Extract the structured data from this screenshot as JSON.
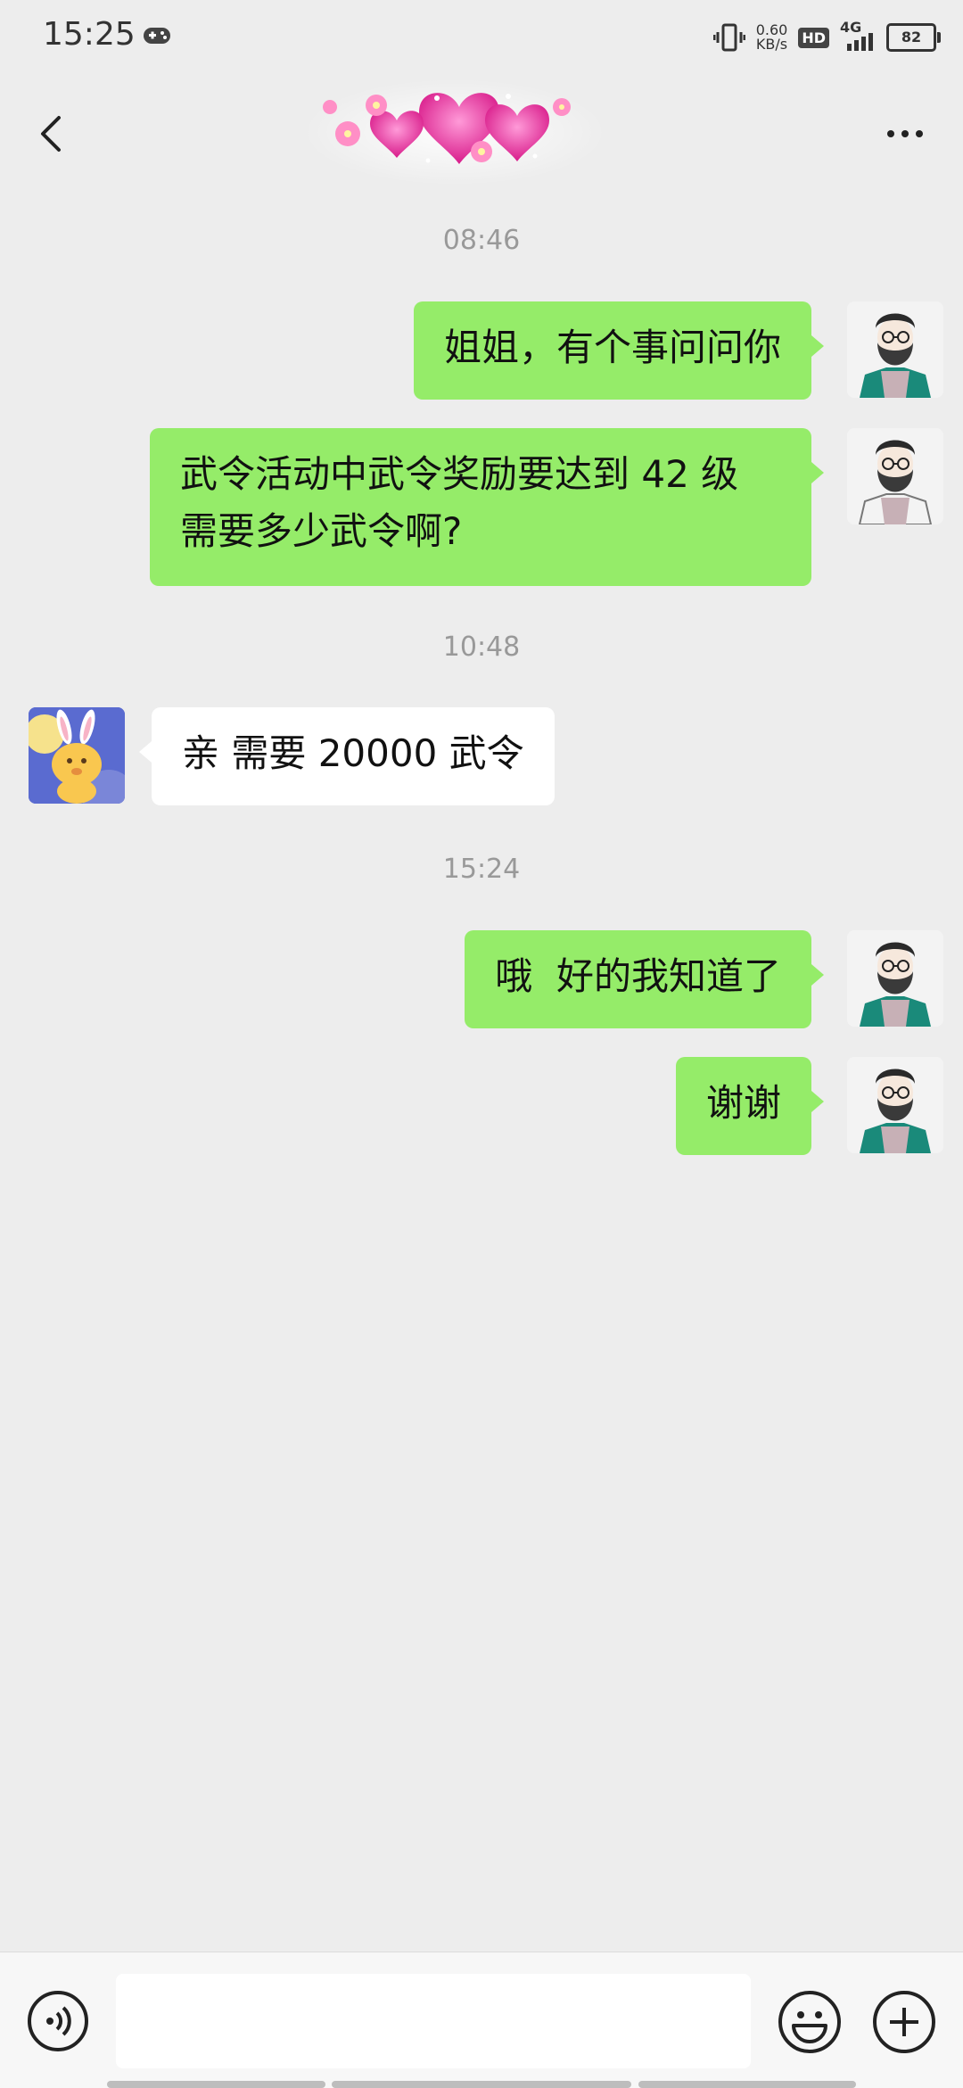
{
  "status_bar": {
    "time": "15:25",
    "net_speed_value": "0.60",
    "net_speed_unit": "KB/s",
    "hd_label": "HD",
    "network_label": "4G",
    "battery": "82"
  },
  "nav": {
    "back_icon": "chevron-left-icon",
    "title_icon": "heart-flower-decoration",
    "more_icon": "more-dots-icon"
  },
  "chat": {
    "messages": [
      {
        "type": "time",
        "text": "08:46"
      },
      {
        "type": "sent",
        "text": "姐姐，有个事问问你"
      },
      {
        "type": "sent",
        "line1": "武令活动中武令奖励要达到 42 级",
        "line2": "需要多少武令啊?"
      },
      {
        "type": "time",
        "text": "10:48"
      },
      {
        "type": "received",
        "text": "亲 需要 20000 武令"
      },
      {
        "type": "time",
        "text": "15:24"
      },
      {
        "type": "sent",
        "text": "哦  好的我知道了"
      },
      {
        "type": "sent",
        "text": "谢谢"
      }
    ]
  },
  "input_bar": {
    "voice_icon": "voice-icon",
    "message_value": "",
    "emoji_icon": "emoji-icon",
    "plus_icon": "plus-icon"
  },
  "colors": {
    "sent_bubble": "#95ec69",
    "received_bubble": "#ffffff",
    "background": "#ededed",
    "time_label": "#999999"
  }
}
